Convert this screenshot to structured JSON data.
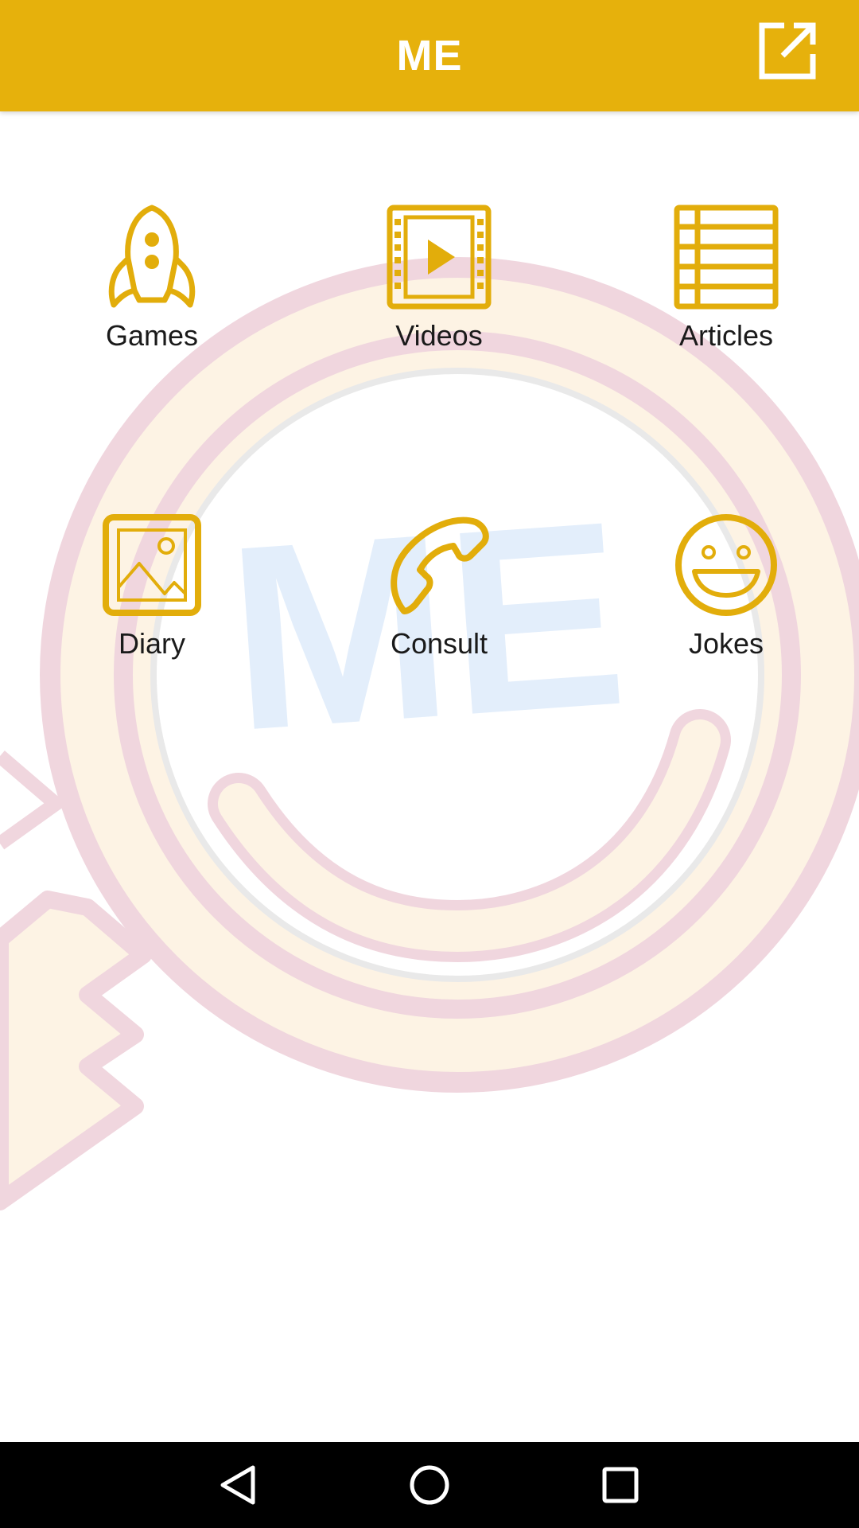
{
  "header": {
    "title": "ME",
    "share_icon": "open-in-new-icon"
  },
  "menu": {
    "items": [
      {
        "label": "Games",
        "icon": "rocket-icon"
      },
      {
        "label": "Videos",
        "icon": "video-film-icon"
      },
      {
        "label": "Articles",
        "icon": "list-lines-icon"
      },
      {
        "label": "Diary",
        "icon": "image-icon"
      },
      {
        "label": "Consult",
        "icon": "phone-icon"
      },
      {
        "label": "Jokes",
        "icon": "smiley-icon"
      }
    ]
  },
  "watermark": {
    "text": "ME"
  },
  "colors": {
    "accent": "#e6b10c",
    "icon": "#e2ad0b",
    "label": "#1a1a1a",
    "navbar": "#000000",
    "watermark_ring": "#f0d6de",
    "watermark_fill": "#fdf3e4",
    "watermark_text": "#e3eefb"
  },
  "navigation": {
    "back_icon": "back-triangle-icon",
    "home_icon": "home-circle-icon",
    "recents_icon": "recents-square-icon"
  }
}
